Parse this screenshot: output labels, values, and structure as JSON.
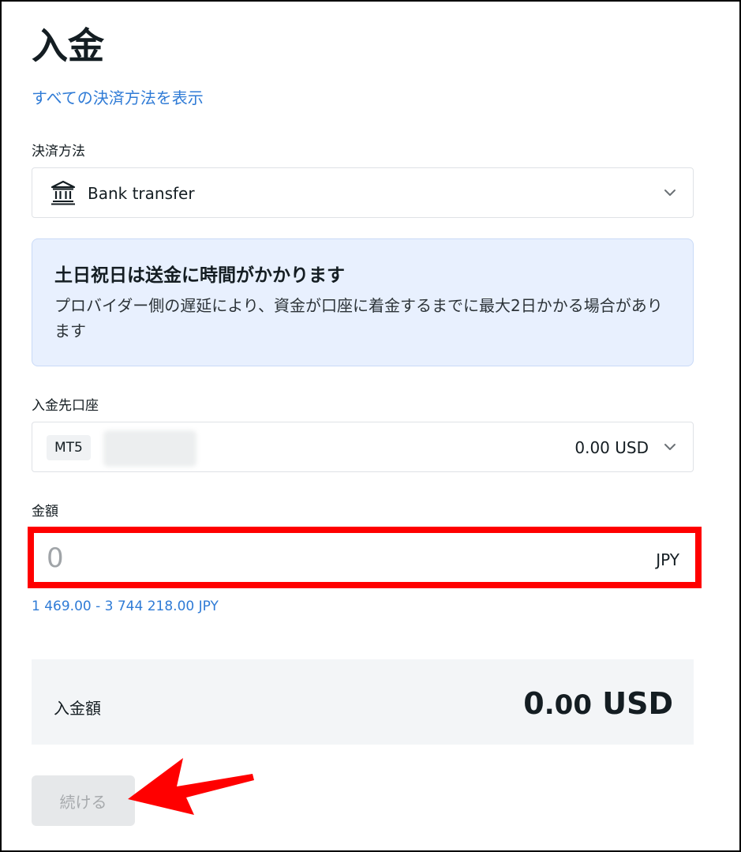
{
  "page": {
    "title": "入金",
    "show_all_methods": "すべての決済方法を表示"
  },
  "payment_method": {
    "label": "決済方法",
    "selected": "Bank transfer",
    "icon": "bank-icon"
  },
  "notice": {
    "title": "土日祝日は送金に時間がかかります",
    "body": "プロバイダー側の遅延により、資金が口座に着金するまでに最大2日かかる場合があります"
  },
  "account": {
    "label": "入金先口座",
    "badge": "MT5",
    "balance": "0.00 USD"
  },
  "amount": {
    "label": "金額",
    "placeholder": "0",
    "currency": "JPY",
    "range": "1 469.00 - 3 744 218.00 JPY"
  },
  "summary": {
    "label": "入金額",
    "amount_int": "0",
    "amount_dec": ".00",
    "currency": "USD"
  },
  "actions": {
    "continue_label": "続ける"
  },
  "colors": {
    "link": "#2f7bd6",
    "highlight": "#ff0000",
    "notice_bg": "#e8f0fe"
  }
}
